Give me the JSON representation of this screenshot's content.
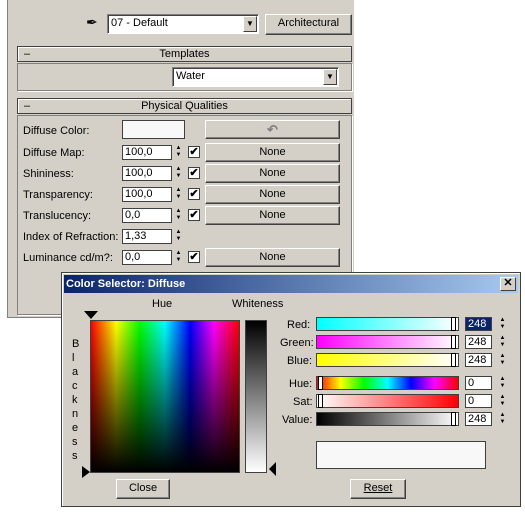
{
  "toolbar": {
    "material_name": "07 - Default",
    "type_button": "Architectural"
  },
  "templates": {
    "collapse": "–",
    "title": "Templates",
    "selected": "Water"
  },
  "physical": {
    "collapse": "–",
    "title": "Physical Qualities",
    "diffuse_color_label": "Diffuse Color:",
    "rows": [
      {
        "label": "Diffuse Map:",
        "value": "100,0",
        "map": "None",
        "checked": "✔"
      },
      {
        "label": "Shininess:",
        "value": "100,0",
        "map": "None",
        "checked": "✔"
      },
      {
        "label": "Transparency:",
        "value": "100,0",
        "map": "None",
        "checked": "✔"
      },
      {
        "label": "Translucency:",
        "value": "0,0",
        "map": "None",
        "checked": "✔"
      },
      {
        "label": "Index of Refraction:",
        "value": "1,33"
      },
      {
        "label": "Luminance cd/m?:",
        "value": "0,0",
        "map": "None",
        "checked": "✔"
      }
    ],
    "undo_icon": "undo-arrow-icon"
  },
  "color_selector": {
    "title": "Color Selector: Diffuse",
    "close_x": "✕",
    "hue_label": "Hue",
    "whiteness_label": "Whiteness",
    "blackness_label": "B l a c k n e s s",
    "channels": [
      {
        "label": "Red:",
        "value": "248"
      },
      {
        "label": "Green:",
        "value": "248"
      },
      {
        "label": "Blue:",
        "value": "248"
      },
      {
        "label": "Hue:",
        "value": "0"
      },
      {
        "label": "Sat:",
        "value": "0"
      },
      {
        "label": "Value:",
        "value": "248"
      }
    ],
    "close_button": "Close",
    "reset_button": "Reset",
    "current_color": "#f8f8f8"
  }
}
